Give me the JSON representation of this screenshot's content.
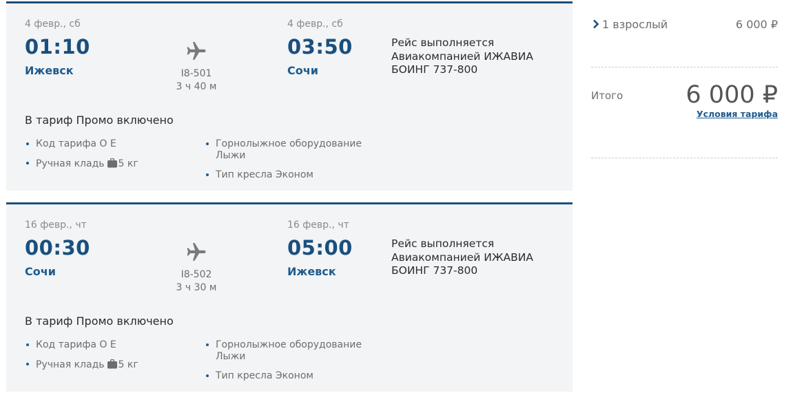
{
  "flights": [
    {
      "dep_date": "4 февр., сб",
      "dep_time": "01:10",
      "dep_city": "Ижевск",
      "arr_date": "4 февр., сб",
      "arr_time": "03:50",
      "arr_city": "Сочи",
      "flight_no": "I8-501",
      "duration": "3 ч 40 м",
      "operator_line1": "Рейс выполняется",
      "operator_line2": "Авиакомпанией ИЖАВИА",
      "aircraft": "БОИНГ 737-800",
      "included_title": "В тариф Промо включено",
      "fare_code": "Код тарифа О Е",
      "hand_luggage_label": "Ручная кладь",
      "hand_luggage_weight": "5 кг",
      "ski_line1": "Горнолыжное оборудование",
      "ski_line2": "Лыжи",
      "seat_type": "Тип кресла Эконом"
    },
    {
      "dep_date": "16 февр., чт",
      "dep_time": "00:30",
      "dep_city": "Сочи",
      "arr_date": "16 февр., чт",
      "arr_time": "05:00",
      "arr_city": "Ижевск",
      "flight_no": "I8-502",
      "duration": "3 ч 30 м",
      "operator_line1": "Рейс выполняется",
      "operator_line2": "Авиакомпанией ИЖАВИА",
      "aircraft": "БОИНГ 737-800",
      "included_title": "В тариф Промо включено",
      "fare_code": "Код тарифа О Е",
      "hand_luggage_label": "Ручная кладь",
      "hand_luggage_weight": "5 кг",
      "ski_line1": "Горнолыжное оборудование",
      "ski_line2": "Лыжи",
      "seat_type": "Тип кресла Эконом"
    }
  ],
  "summary": {
    "passenger_label": "1 взрослый",
    "passenger_price": "6 000 ₽",
    "total_label": "Итого",
    "total_price": "6 000 ₽",
    "tariff_conditions_link": "Условия тарифа"
  },
  "icons": {
    "plane": "airplane-icon",
    "bag": "bag-icon",
    "chevron": "chevron-right-icon"
  },
  "colors": {
    "accent": "#1a4f7e",
    "card_bg": "#f2f4f5",
    "muted_text": "#6d6d6d"
  }
}
